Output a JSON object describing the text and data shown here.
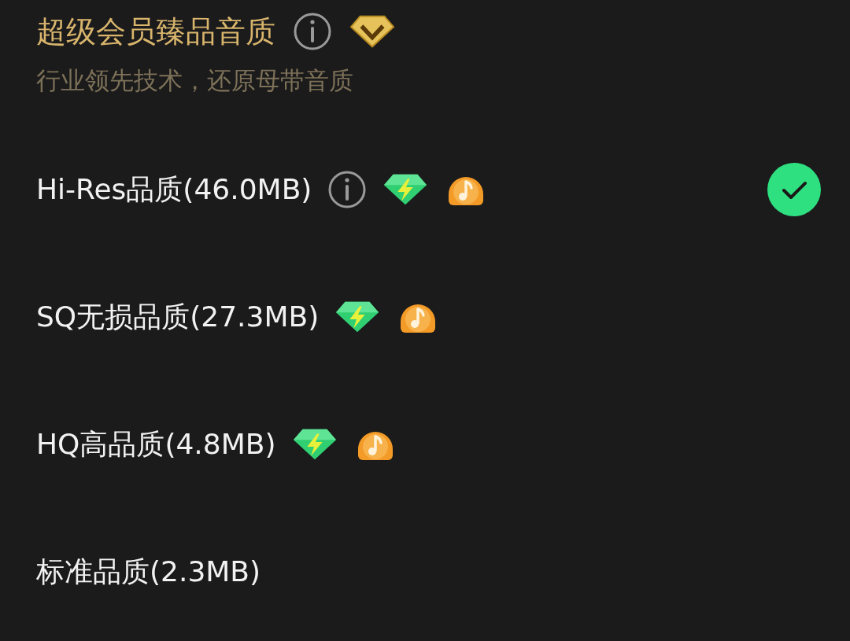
{
  "header": {
    "title": "超级会员臻品音质",
    "info": true,
    "vip_badge": true,
    "subtitle": "行业领先技术，还原母带音质"
  },
  "options": [
    {
      "label": "Hi-Res品质(46.0MB)",
      "info": true,
      "svip_badge": true,
      "music_badge": true,
      "selected": true
    },
    {
      "label": "SQ无损品质(27.3MB)",
      "svip_badge": true,
      "music_badge": true,
      "selected": false
    },
    {
      "label": "HQ高品质(4.8MB)",
      "svip_badge": true,
      "music_badge": true,
      "selected": false
    },
    {
      "label": "标准品质(2.3MB)",
      "selected": false
    }
  ]
}
